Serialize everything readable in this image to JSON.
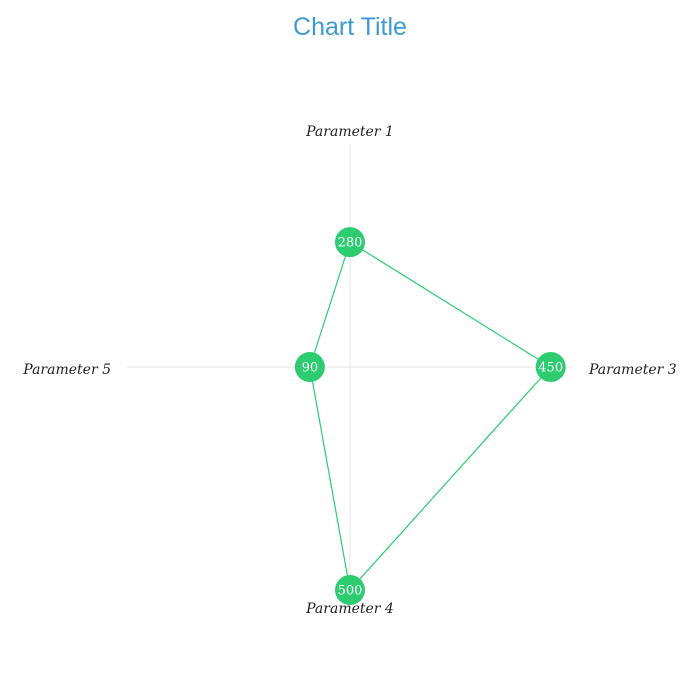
{
  "chart_data": {
    "type": "radar",
    "title": "Chart Title",
    "categories": [
      "Parameter 1",
      "Parameter 3",
      "Parameter 4",
      "Parameter 5"
    ],
    "series": [
      {
        "values": [
          280,
          450,
          500,
          90
        ],
        "color": "#2ecc71"
      }
    ],
    "max_value": 500,
    "grid": true,
    "grid_color": "#e6e6e6",
    "label_color": "#ffffff"
  }
}
